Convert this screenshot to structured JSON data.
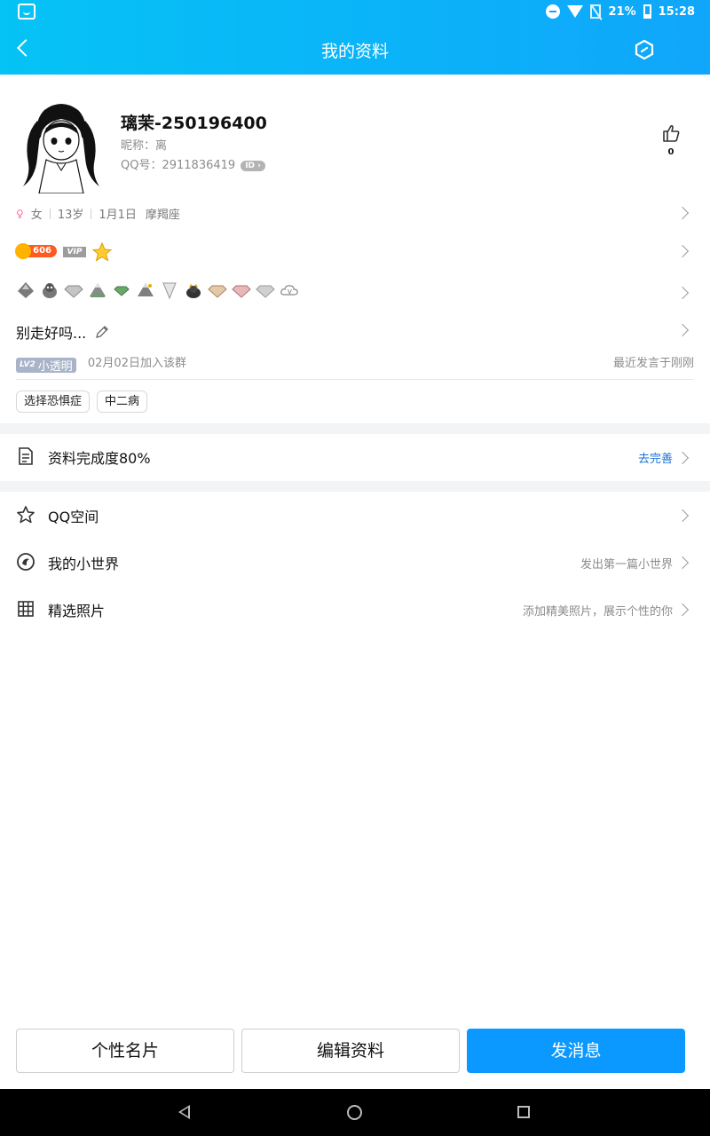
{
  "status_bar": {
    "battery": "21%",
    "time": "15:28"
  },
  "nav": {
    "title": "我的资料"
  },
  "profile": {
    "name": "璃茉-250196400",
    "nickname": "昵称：离",
    "qq": "QQ号：2911836419",
    "id_badge": "ID",
    "likes": "0"
  },
  "basic": {
    "gender": "女",
    "age": "13岁",
    "birthday": "1月1日",
    "zodiac": "摩羯座"
  },
  "level": {
    "value": "606",
    "vip": "VIP"
  },
  "signature": "别走好吗...",
  "group": {
    "level": "LV2",
    "title": "小透明",
    "joined": "02月02日加入该群",
    "last_speak": "最近发言于刚刚"
  },
  "tags": [
    "选择恐惧症",
    "中二病"
  ],
  "menu": {
    "completion": {
      "label": "资料完成度80%",
      "action": "去完善"
    },
    "qzone": {
      "label": "QQ空间"
    },
    "world": {
      "label": "我的小世界",
      "hint": "发出第一篇小世界"
    },
    "photos": {
      "label": "精选照片",
      "hint": "添加精美照片，展示个性的你"
    }
  },
  "buttons": {
    "card": "个性名片",
    "edit": "编辑资料",
    "message": "发消息"
  },
  "colors": {
    "header": "#10a6fb",
    "primary": "#0b99ff",
    "link": "#1a73d9",
    "gender": "#ff6fa6"
  }
}
